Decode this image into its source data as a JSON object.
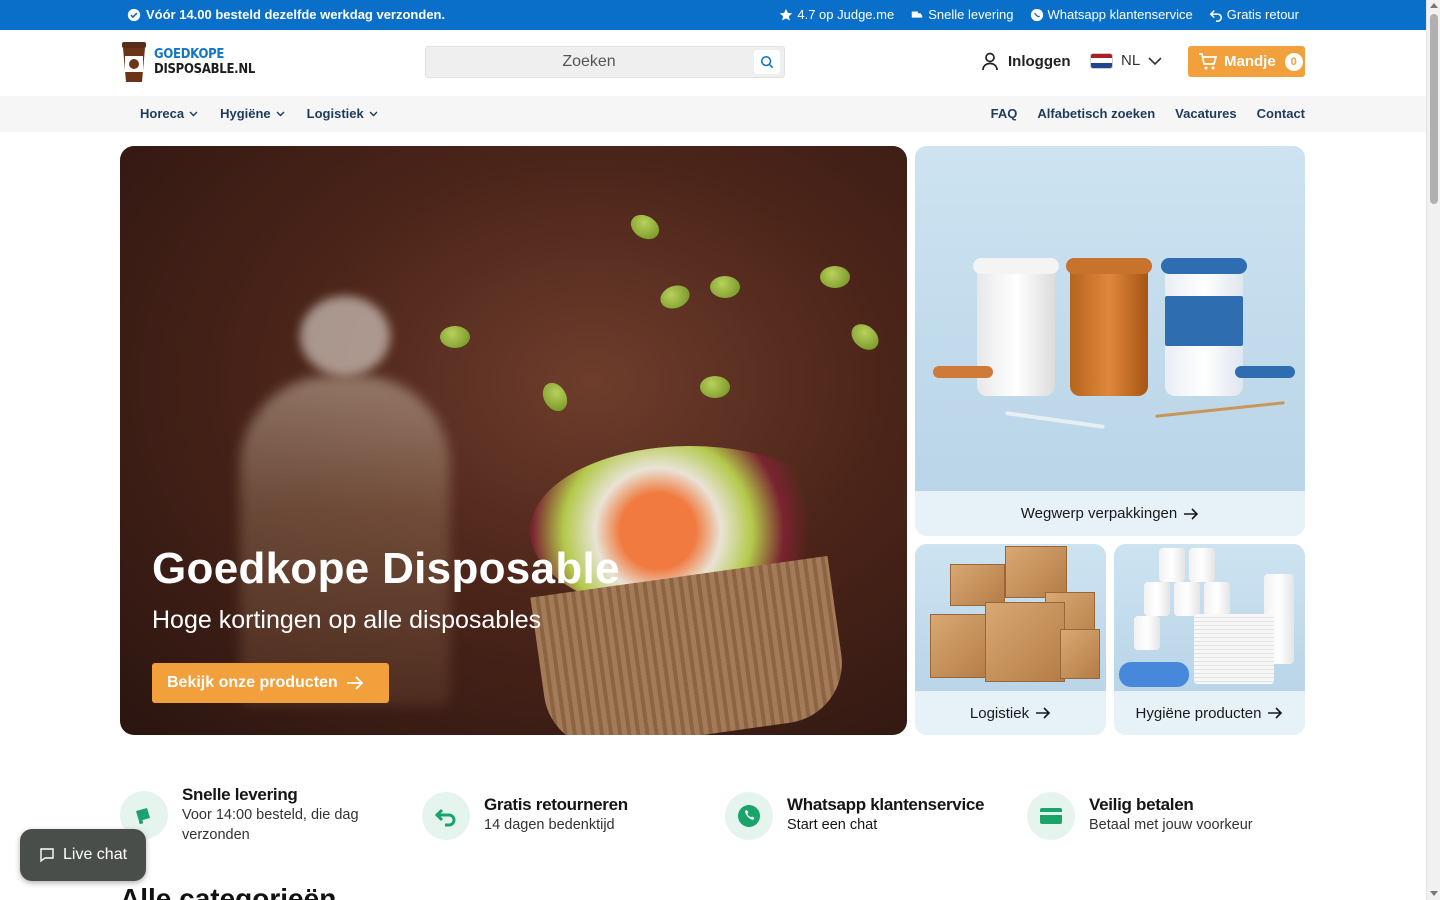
{
  "topbar": {
    "announcement": "Vóór 14.00 besteld dezelfde werkdag verzonden.",
    "rating": "4.7 op Judge.me",
    "fast_delivery": "Snelle levering",
    "whatsapp": "Whatsapp klantenservice",
    "free_return": "Gratis retour"
  },
  "header": {
    "logo_line1": "GOEDKOPE",
    "logo_line2": "DISPOSABLE.NL",
    "search_placeholder": "Zoeken",
    "login_label": "Inloggen",
    "language": "NL",
    "cart_label": "Mandje",
    "cart_count": "0"
  },
  "nav": {
    "categories": [
      "Horeca",
      "Hygiëne",
      "Logistiek"
    ],
    "links": [
      "FAQ",
      "Alfabetisch zoeken",
      "Vacatures",
      "Contact"
    ]
  },
  "hero": {
    "title": "Goedkope Disposable",
    "subtitle": "Hoge kortingen op alle disposables",
    "cta": "Bekijk onze producten"
  },
  "cards": {
    "packaging": "Wegwerp verpakkingen",
    "logistics": "Logistiek",
    "hygiene": "Hygiëne producten"
  },
  "usps": [
    {
      "title": "Snelle levering",
      "desc": "Voor 14:00 besteld, die dag verzonden",
      "icon": "truck-icon"
    },
    {
      "title": "Gratis retourneren",
      "desc": "14 dagen bedenktijd",
      "icon": "return-icon"
    },
    {
      "title": "Whatsapp klantenservice",
      "desc": "Start een chat",
      "icon": "whatsapp-icon"
    },
    {
      "title": "Veilig betalen",
      "desc": "Betaal met jouw voorkeur",
      "icon": "credit-card-icon"
    }
  ],
  "section_title": "Alle categorieën",
  "livechat": "Live chat",
  "colors": {
    "topbar": "#0a6fc9",
    "accent": "#f2a03c",
    "nav_text": "#1d3b5c",
    "card_bg": "#d6e8f3",
    "usp_icon": "#1aa36b"
  }
}
